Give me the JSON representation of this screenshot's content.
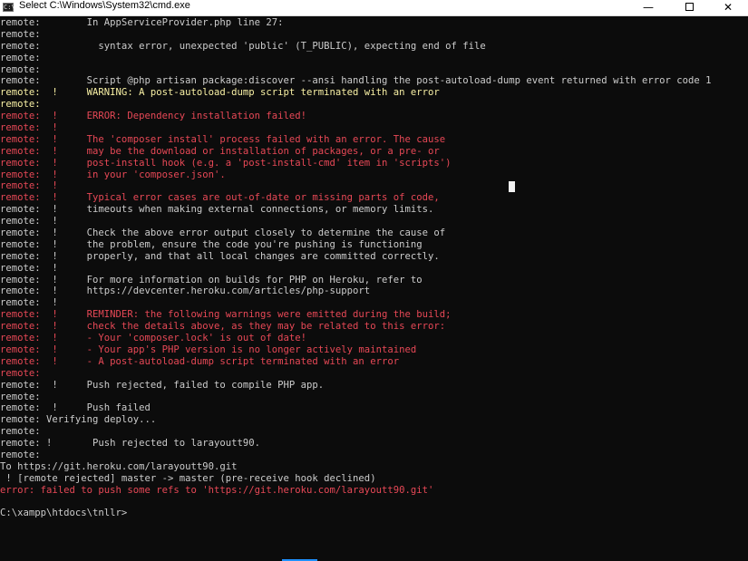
{
  "window": {
    "title": "Select C:\\Windows\\System32\\cmd.exe",
    "icon": "cmd-icon",
    "icon_glyph": "C:\\",
    "minimize_glyph": "—",
    "close_glyph": "✕"
  },
  "lines": [
    {
      "text": "remote:        In AppServiceProvider.php line 27:",
      "color": "w"
    },
    {
      "text": "remote:",
      "color": "w"
    },
    {
      "text": "remote:          syntax error, unexpected 'public' (T_PUBLIC), expecting end of file",
      "color": "w"
    },
    {
      "text": "remote:",
      "color": "w"
    },
    {
      "text": "remote:",
      "color": "w"
    },
    {
      "text": "remote:        Script @php artisan package:discover --ansi handling the post-autoload-dump event returned with error code 1",
      "color": "w"
    },
    {
      "text": "remote:  !     WARNING: A post-autoload-dump script terminated with an error",
      "color": "y"
    },
    {
      "text": "remote:",
      "color": "y"
    },
    {
      "text": "remote:  !     ERROR: Dependency installation failed!",
      "color": "r"
    },
    {
      "text": "remote:  !",
      "color": "r"
    },
    {
      "text": "remote:  !     The 'composer install' process failed with an error. The cause",
      "color": "r"
    },
    {
      "text": "remote:  !     may be the download or installation of packages, or a pre- or",
      "color": "r"
    },
    {
      "text": "remote:  !     post-install hook (e.g. a 'post-install-cmd' item in 'scripts')",
      "color": "r"
    },
    {
      "text": "remote:  !     in your 'composer.json'.",
      "color": "r"
    },
    {
      "text": "remote:  !",
      "color": "r"
    },
    {
      "text": "remote:  !     Typical error cases are out-of-date or missing parts of code,",
      "color": "r"
    },
    {
      "text": "remote:  !     timeouts when making external connections, or memory limits.",
      "color": "w"
    },
    {
      "text": "remote:  !",
      "color": "w"
    },
    {
      "text": "remote:  !     Check the above error output closely to determine the cause of",
      "color": "w"
    },
    {
      "text": "remote:  !     the problem, ensure the code you're pushing is functioning",
      "color": "w"
    },
    {
      "text": "remote:  !     properly, and that all local changes are committed correctly.",
      "color": "w"
    },
    {
      "text": "remote:  !",
      "color": "w"
    },
    {
      "text": "remote:  !     For more information on builds for PHP on Heroku, refer to",
      "color": "w"
    },
    {
      "text": "remote:  !     https://devcenter.heroku.com/articles/php-support",
      "color": "w"
    },
    {
      "text": "remote:  !",
      "color": "w"
    },
    {
      "text": "remote:  !     REMINDER: the following warnings were emitted during the build;",
      "color": "r"
    },
    {
      "text": "remote:  !     check the details above, as they may be related to this error:",
      "color": "r"
    },
    {
      "text": "remote:  !     - Your 'composer.lock' is out of date!",
      "color": "r"
    },
    {
      "text": "remote:  !     - Your app's PHP version is no longer actively maintained",
      "color": "r"
    },
    {
      "text": "remote:  !     - A post-autoload-dump script terminated with an error",
      "color": "r"
    },
    {
      "text": "remote:",
      "color": "r"
    },
    {
      "text": "remote:  !     Push rejected, failed to compile PHP app.",
      "color": "w"
    },
    {
      "text": "remote:",
      "color": "w"
    },
    {
      "text": "remote:  !     Push failed",
      "color": "w"
    },
    {
      "text": "remote: Verifying deploy...",
      "color": "w"
    },
    {
      "text": "remote:",
      "color": "w"
    },
    {
      "text": "remote: !       Push rejected to larayoutt90.",
      "color": "w"
    },
    {
      "text": "remote:",
      "color": "w"
    },
    {
      "text": "To https://git.heroku.com/larayoutt90.git",
      "color": "w"
    },
    {
      "text": " ! [remote rejected] master -> master (pre-receive hook declined)",
      "color": "w"
    },
    {
      "text": "error: failed to push some refs to 'https://git.heroku.com/larayoutt90.git'",
      "color": "r"
    },
    {
      "text": "",
      "color": "w"
    },
    {
      "text": "C:\\xampp\\htdocs\\tnllr>",
      "color": "w"
    }
  ]
}
